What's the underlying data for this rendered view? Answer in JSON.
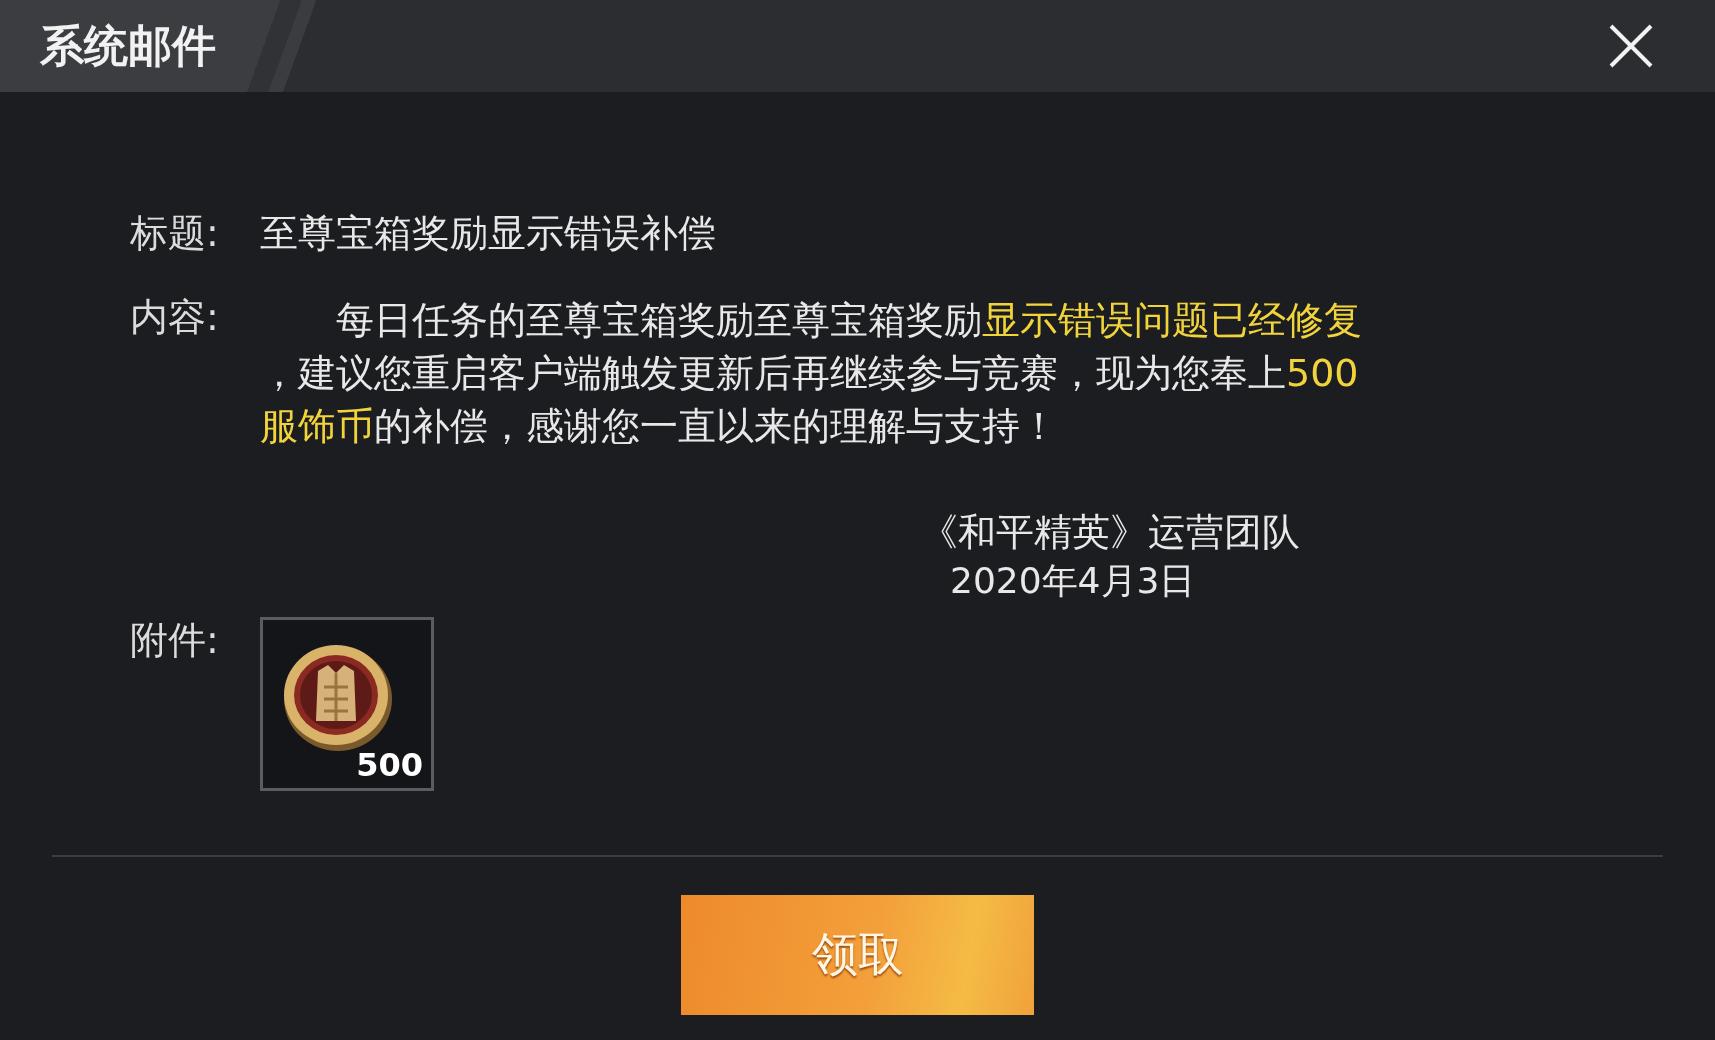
{
  "window": {
    "title": "系统邮件"
  },
  "subject": {
    "label": "标题:",
    "value": "至尊宝箱奖励显示错误补偿"
  },
  "content": {
    "label": "内容:",
    "lines": [
      [
        {
          "text": "每日任务的至尊宝箱奖励至尊宝箱奖励",
          "highlight": false
        },
        {
          "text": "显示错误问题已经修复",
          "highlight": true
        }
      ],
      [
        {
          "text": "，建议您重启客户端触发更新后再继续参与竞赛，现为您奉上",
          "highlight": false
        },
        {
          "text": "500",
          "highlight": true
        }
      ],
      [
        {
          "text": "服饰币",
          "highlight": true
        },
        {
          "text": "的补偿，感谢您一直以来的理解与支持！",
          "highlight": false
        }
      ]
    ],
    "signature": "《和平精英》运营团队",
    "date": "2020年4月3日"
  },
  "attachments": {
    "label": "附件:",
    "items": [
      {
        "count": "500"
      }
    ]
  },
  "claim_button": "领取"
}
